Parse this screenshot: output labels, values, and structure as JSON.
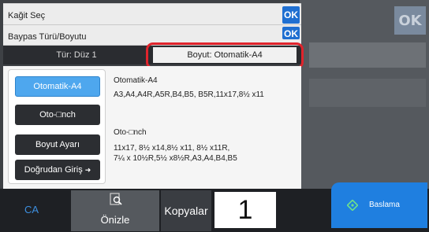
{
  "dialog": {
    "title": "Kağit Seç",
    "ok_label": "OK",
    "subtitle": "Baypas Türü/Boyutu",
    "sub_ok_label": "OK"
  },
  "tabs": {
    "type_tab": "Tür:   Düz 1",
    "size_tab": "Boyut: Otomatik-A4"
  },
  "options": {
    "auto_a4": "Otomatik-A4",
    "auto_inch": "Oto-□nch",
    "size_setting": "Boyut Ayarı",
    "direct_input": "Doğrudan Giriş"
  },
  "info": {
    "auto_a4_title": "Otomatik-A4",
    "auto_a4_sizes": "A3,A4,A4R,A5R,B4,B5, B5R,11x17,8½ x11",
    "auto_inch_title": "Oto-□nch",
    "auto_inch_sizes_1": "11x17, 8½ x14,8½ x11, 8½ x11R,",
    "auto_inch_sizes_2": "7¼ x 10½R,5½ x8½R,A3,A4,B4,B5"
  },
  "background": {
    "ok_label": "OK"
  },
  "bottom": {
    "ca_label": "CA",
    "preview_label": "Önizle",
    "copies_label": "Kopyalar",
    "copies_value": "1",
    "start_label": "Baslama"
  },
  "colors": {
    "accent": "#1f6fd1",
    "selected": "#4ea7ee",
    "highlight": "#e0242c",
    "start": "#1f7fe0"
  }
}
